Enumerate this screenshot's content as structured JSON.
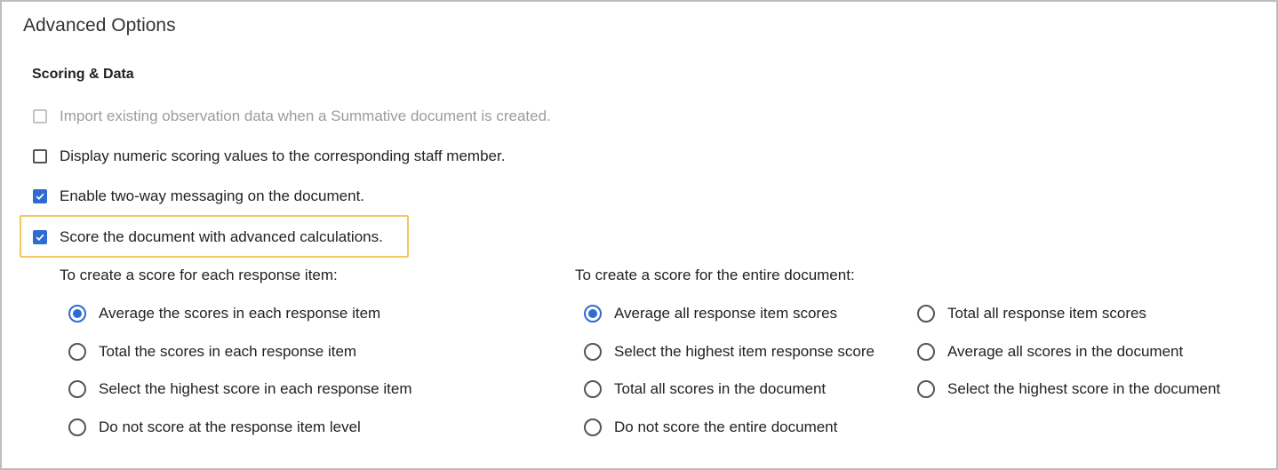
{
  "panel": {
    "title": "Advanced Options"
  },
  "section": {
    "title": "Scoring & Data"
  },
  "checkboxes": [
    {
      "label": "Import existing observation data when a Summative document is created.",
      "checked": false,
      "disabled": true
    },
    {
      "label": "Display numeric scoring values to the corresponding staff member.",
      "checked": false,
      "disabled": false
    },
    {
      "label": "Enable two-way messaging on the document.",
      "checked": true,
      "disabled": false
    },
    {
      "label": "Score the document with advanced calculations.",
      "checked": true,
      "disabled": false,
      "highlighted": true
    }
  ],
  "item_scoring": {
    "title": "To create a score for each response item:",
    "options": [
      {
        "label": "Average the scores in each response item",
        "selected": true
      },
      {
        "label": "Total the scores in each response item",
        "selected": false
      },
      {
        "label": "Select the highest score in each response item",
        "selected": false
      },
      {
        "label": "Do not score at the response item level",
        "selected": false
      }
    ]
  },
  "document_scoring": {
    "title": "To create a score for the entire document:",
    "options": [
      {
        "label": "Average all response item scores",
        "selected": true
      },
      {
        "label": "Select the highest item response score",
        "selected": false
      },
      {
        "label": "Total all scores in the document",
        "selected": false
      },
      {
        "label": "Do not score the entire document",
        "selected": false
      },
      {
        "label": "Total all response item scores",
        "selected": false
      },
      {
        "label": "Average all scores in the document",
        "selected": false
      },
      {
        "label": "Select the highest score in the document",
        "selected": false
      }
    ]
  },
  "colors": {
    "accent": "#2f6bd1",
    "highlight": "#f1c760",
    "disabled_text": "#9c9c9c"
  }
}
